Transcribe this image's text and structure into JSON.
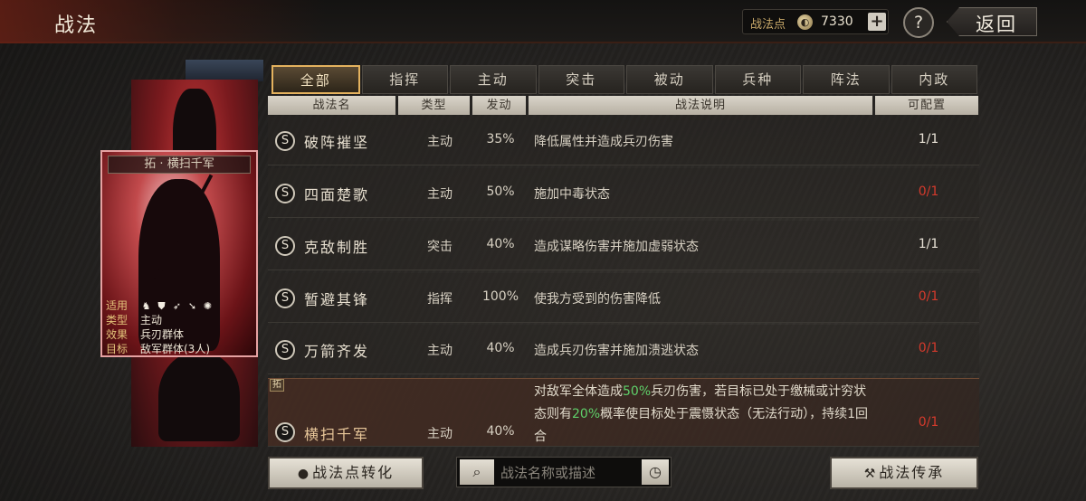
{
  "header": {
    "title": "战法",
    "points_label": "战法点",
    "points_value": "7330",
    "plus_label": "+",
    "help_label": "?",
    "back_label": "返回"
  },
  "card": {
    "title": "拓 · 横扫千军",
    "suit_key": "适用",
    "type_key": "类型",
    "type_val": "主动",
    "effect_key": "效果",
    "effect_val": "兵刃群体",
    "target_key": "目标",
    "target_val": "敌军群体(3人)",
    "unit_icons": [
      "cavalry-icon",
      "shield-icon",
      "bow-icon",
      "spear-icon",
      "siege-icon"
    ]
  },
  "tabs": [
    {
      "label": "全部",
      "active": true
    },
    {
      "label": "指挥"
    },
    {
      "label": "主动"
    },
    {
      "label": "突击"
    },
    {
      "label": "被动"
    },
    {
      "label": "兵种"
    },
    {
      "label": "阵法"
    },
    {
      "label": "内政"
    }
  ],
  "columns": {
    "name": "战法名",
    "type": "类型",
    "rate": "发动",
    "desc": "战法说明",
    "count": "可配置"
  },
  "rows": [
    {
      "grade": "S",
      "name": "破阵摧坚",
      "type": "主动",
      "rate": "35%",
      "desc": "降低属性并造成兵刃伤害",
      "count": "1/1",
      "count_color": "#e8e2d6"
    },
    {
      "grade": "S",
      "name": "四面楚歌",
      "type": "主动",
      "rate": "50%",
      "desc": "施加中毒状态",
      "count": "0/1",
      "count_color": "#d43a2c"
    },
    {
      "grade": "S",
      "name": "克敌制胜",
      "type": "突击",
      "rate": "40%",
      "desc": "造成谋略伤害并施加虚弱状态",
      "count": "1/1",
      "count_color": "#e8e2d6"
    },
    {
      "grade": "S",
      "name": "暂避其锋",
      "type": "指挥",
      "rate": "100%",
      "desc": "使我方受到的伤害降低",
      "count": "0/1",
      "count_color": "#d43a2c"
    },
    {
      "grade": "S",
      "name": "万箭齐发",
      "type": "主动",
      "rate": "40%",
      "desc": "造成兵刃伤害并施加溃逃状态",
      "count": "0/1",
      "count_color": "#d43a2c"
    }
  ],
  "special_row": {
    "tag": "拓",
    "grade": "S",
    "name": "横扫千军",
    "type": "主动",
    "rate": "40%",
    "count": "0/1",
    "desc_p1": "对敌军全体造成",
    "desc_h1": "50%",
    "desc_p2": "兵刃伤害，若目标已处于缴械或计穷状态则有",
    "desc_h2": "20%",
    "desc_p3": "概率使目标处于震慑状态（无法行动），持续1回合"
  },
  "footer": {
    "convert_label": "战法点转化",
    "search_placeholder": "战法名称或描述",
    "inherit_label": "战法传承"
  },
  "colors": {
    "accent": "#e4b25e",
    "highlight_green": "#5fd06a",
    "unavailable_red": "#d43a2c"
  }
}
